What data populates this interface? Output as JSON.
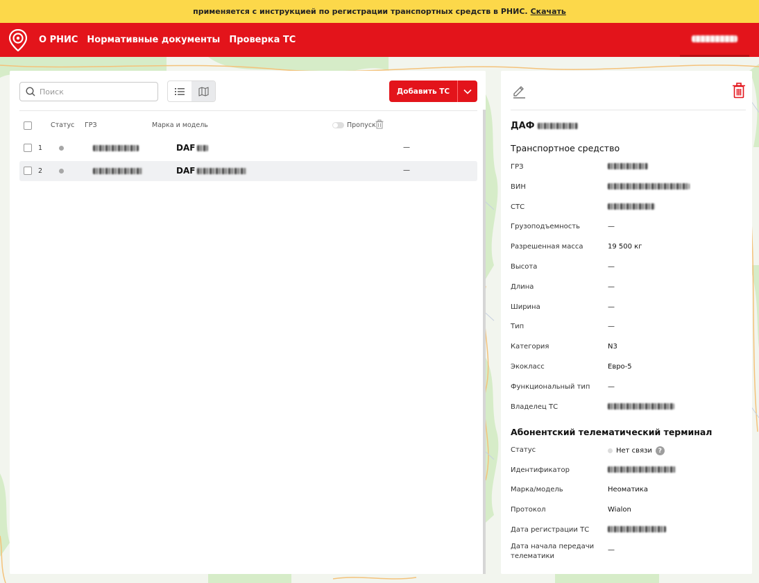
{
  "banner": {
    "text": "применяется с инструкцией по регистрации транспортных средств в РНИС.",
    "link": "Скачать"
  },
  "header": {
    "nav": [
      "О РНИС",
      "Нормативные документы",
      "Проверка ТС"
    ]
  },
  "toolbar": {
    "search_placeholder": "Поиск",
    "add_button": "Добавить ТС"
  },
  "table": {
    "columns": {
      "status": "Статус",
      "grz": "ГРЗ",
      "model": "Марка и модель",
      "pass": "Пропуск"
    },
    "rows": [
      {
        "num": "1",
        "model": "DAF",
        "pass": "—",
        "selected": false
      },
      {
        "num": "2",
        "model": "DAF",
        "pass": "—",
        "selected": true
      }
    ]
  },
  "detail": {
    "title": "ДАФ",
    "vehicle_section": "Транспортное средство",
    "vehicle_props": [
      {
        "k": "ГРЗ",
        "v": "",
        "blur": true,
        "w": 58
      },
      {
        "k": "ВИН",
        "v": "",
        "blur": true,
        "w": 118
      },
      {
        "k": "СТС",
        "v": "",
        "blur": true,
        "w": 68
      },
      {
        "k": "Грузоподъемность",
        "v": "—"
      },
      {
        "k": "Разрешенная масса",
        "v": "19 500 кг"
      },
      {
        "k": "Высота",
        "v": "—"
      },
      {
        "k": "Длина",
        "v": "—"
      },
      {
        "k": "Ширина",
        "v": "—"
      },
      {
        "k": "Тип",
        "v": "—"
      },
      {
        "k": "Категория",
        "v": "N3"
      },
      {
        "k": "Экокласс",
        "v": "Евро-5"
      },
      {
        "k": "Функциональный тип",
        "v": "—"
      },
      {
        "k": "Владелец ТС",
        "v": "",
        "blur": true,
        "w": 96
      }
    ],
    "terminal_section": "Абонентский телематический терминал",
    "terminal_props": [
      {
        "k": "Статус",
        "v": "Нет связи",
        "status": true
      },
      {
        "k": "Идентификатор",
        "v": "",
        "blur": true,
        "w": 98
      },
      {
        "k": "Марка/модель",
        "v": "Неоматика"
      },
      {
        "k": "Протокол",
        "v": "Wialon"
      },
      {
        "k": "Дата регистрации ТС",
        "v": "",
        "blur": true,
        "w": 84
      },
      {
        "k": "Дата начала передачи\nтелематики",
        "v": "—",
        "multiline": true
      }
    ]
  },
  "colors": {
    "brand": "#e3141b",
    "banner": "#fcd84a"
  }
}
